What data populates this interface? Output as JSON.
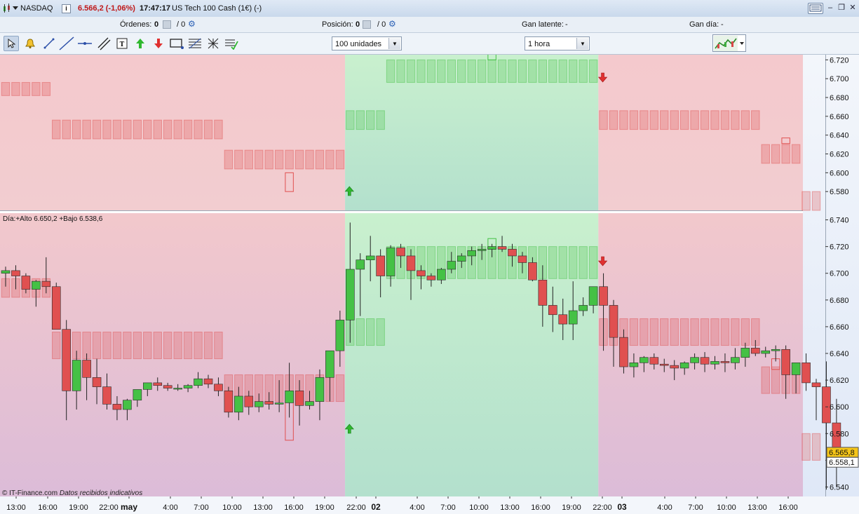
{
  "titlebar": {
    "market": "NASDAQ",
    "price": "6.566,2 (-1,06%)",
    "time": "17:47:17",
    "instrument": "US Tech 100 Cash (1€) (-)"
  },
  "statusbar": {
    "orders_label": "Órdenes:",
    "orders_value": "0",
    "orders_sep": "/ 0",
    "position_label": "Posición:",
    "position_value": "0",
    "position_sep": "/ 0",
    "latent_label": "Gan latente:",
    "latent_value": "-",
    "day_label": "Gan día:",
    "day_value": "-"
  },
  "toolbar": {
    "units_select": "100 unidades",
    "timeframe_select": "1 hora"
  },
  "tools": [
    "pointer-icon",
    "bell-icon",
    "segment-icon",
    "line-icon",
    "horizontal-line-icon",
    "channel-icon",
    "text-icon",
    "buy-arrow-icon",
    "sell-arrow-icon",
    "rectangle-icon",
    "fibonacci-icon",
    "grid-icon",
    "indicator-icon"
  ],
  "chart": {
    "info_label": "Día:+Alto 6.650,2 +Bajo 6.538,6",
    "last_price_tag": "6.565,8",
    "second_price_tag": "6.558,1",
    "footer_brand": "© IT-Finance.com",
    "footer_note": "Datos recibidos indicativos",
    "colors": {
      "bull": "#45c145",
      "bear": "#e05050",
      "bg_red": "#f2c8cc",
      "bg_green": "#c7ecd4",
      "bg_purple": "#dcb8d6"
    },
    "y_ticks_top": [
      "6.720",
      "6.700",
      "6.680",
      "6.660",
      "6.640",
      "6.620",
      "6.600",
      "6.580"
    ],
    "y_ticks_main": [
      "6.740",
      "6.720",
      "6.700",
      "6.680",
      "6.660",
      "6.640",
      "6.620",
      "6.600",
      "6.580",
      "6.560",
      "6.540"
    ],
    "x_ticks": [
      "13:00",
      "16:00",
      "19:00",
      "22:00",
      "may",
      "4:00",
      "7:00",
      "10:00",
      "13:00",
      "16:00",
      "19:00",
      "22:00",
      "02",
      "4:00",
      "7:00",
      "10:00",
      "13:00",
      "16:00",
      "19:00",
      "22:00",
      "03",
      "4:00",
      "7:00",
      "10:00",
      "13:00",
      "16:00"
    ],
    "bold_x": [
      "may",
      "02",
      "03"
    ]
  },
  "chart_data": {
    "type": "candlestick",
    "title": "US Tech 100 Cash (1€)",
    "timeframe": "1 hora",
    "ylim": [
      6530,
      6745
    ],
    "candles": [
      [
        6700,
        6705,
        6690,
        6702
      ],
      [
        6702,
        6706,
        6688,
        6698
      ],
      [
        6698,
        6700,
        6685,
        6688
      ],
      [
        6688,
        6695,
        6675,
        6694
      ],
      [
        6694,
        6712,
        6685,
        6690
      ],
      [
        6690,
        6693,
        6660,
        6658
      ],
      [
        6658,
        6665,
        6590,
        6612
      ],
      [
        6612,
        6642,
        6598,
        6635
      ],
      [
        6635,
        6640,
        6605,
        6622
      ],
      [
        6622,
        6636,
        6602,
        6615
      ],
      [
        6615,
        6625,
        6598,
        6602
      ],
      [
        6602,
        6608,
        6590,
        6598
      ],
      [
        6598,
        6606,
        6590,
        6605
      ],
      [
        6605,
        6610,
        6600,
        6613
      ],
      [
        6613,
        6618,
        6608,
        6618
      ],
      [
        6618,
        6622,
        6612,
        6616
      ],
      [
        6616,
        6618,
        6612,
        6614
      ],
      [
        6614,
        6617,
        6612,
        6614
      ],
      [
        6614,
        6617,
        6611,
        6616
      ],
      [
        6616,
        6626,
        6614,
        6621
      ],
      [
        6621,
        6624,
        6614,
        6617
      ],
      [
        6617,
        6622,
        6608,
        6612
      ],
      [
        6612,
        6615,
        6592,
        6596
      ],
      [
        6596,
        6615,
        6590,
        6608
      ],
      [
        6608,
        6612,
        6594,
        6600
      ],
      [
        6600,
        6610,
        6596,
        6604
      ],
      [
        6604,
        6611,
        6598,
        6602
      ],
      [
        6602,
        6620,
        6596,
        6603
      ],
      [
        6603,
        6633,
        6592,
        6612
      ],
      [
        6612,
        6620,
        6586,
        6601
      ],
      [
        6601,
        6612,
        6598,
        6604
      ],
      [
        6604,
        6628,
        6590,
        6622
      ],
      [
        6622,
        6640,
        6604,
        6642
      ],
      [
        6642,
        6672,
        6630,
        6665
      ],
      [
        6665,
        6738,
        6648,
        6703
      ],
      [
        6703,
        6715,
        6668,
        6710
      ],
      [
        6710,
        6728,
        6694,
        6713
      ],
      [
        6713,
        6718,
        6682,
        6698
      ],
      [
        6698,
        6721,
        6690,
        6719
      ],
      [
        6719,
        6722,
        6704,
        6713
      ],
      [
        6713,
        6718,
        6680,
        6702
      ],
      [
        6702,
        6706,
        6688,
        6698
      ],
      [
        6698,
        6700,
        6690,
        6695
      ],
      [
        6695,
        6704,
        6692,
        6703
      ],
      [
        6703,
        6716,
        6700,
        6709
      ],
      [
        6709,
        6715,
        6704,
        6713
      ],
      [
        6713,
        6720,
        6706,
        6717
      ],
      [
        6717,
        6722,
        6710,
        6718
      ],
      [
        6718,
        6722,
        6712,
        6720
      ],
      [
        6720,
        6728,
        6716,
        6718
      ],
      [
        6718,
        6722,
        6705,
        6713
      ],
      [
        6713,
        6716,
        6700,
        6708
      ],
      [
        6708,
        6712,
        6694,
        6695
      ],
      [
        6695,
        6706,
        6660,
        6676
      ],
      [
        6676,
        6690,
        6656,
        6669
      ],
      [
        6669,
        6681,
        6650,
        6662
      ],
      [
        6662,
        6694,
        6650,
        6672
      ],
      [
        6672,
        6682,
        6668,
        6676
      ],
      [
        6676,
        6690,
        6670,
        6690
      ],
      [
        6690,
        6700,
        6642,
        6676
      ],
      [
        6676,
        6680,
        6630,
        6652
      ],
      [
        6652,
        6658,
        6625,
        6630
      ],
      [
        6630,
        6640,
        6622,
        6633
      ],
      [
        6633,
        6638,
        6626,
        6637
      ],
      [
        6637,
        6640,
        6628,
        6632
      ],
      [
        6632,
        6636,
        6626,
        6631
      ],
      [
        6631,
        6635,
        6620,
        6629
      ],
      [
        6629,
        6634,
        6624,
        6633
      ],
      [
        6633,
        6640,
        6628,
        6637
      ],
      [
        6637,
        6641,
        6626,
        6632
      ],
      [
        6632,
        6638,
        6628,
        6634
      ],
      [
        6634,
        6640,
        6626,
        6633
      ],
      [
        6633,
        6644,
        6628,
        6637
      ],
      [
        6637,
        6648,
        6630,
        6644
      ],
      [
        6644,
        6650,
        6638,
        6640
      ],
      [
        6640,
        6645,
        6637,
        6642
      ],
      [
        6642,
        6646,
        6634,
        6643
      ],
      [
        6643,
        6646,
        6606,
        6624
      ],
      [
        6624,
        6632,
        6610,
        6633
      ],
      [
        6633,
        6640,
        6612,
        6618
      ],
      [
        6618,
        6621,
        6590,
        6615
      ],
      [
        6615,
        6634,
        6538,
        6588
      ],
      [
        6588,
        6606,
        6540,
        6558
      ]
    ],
    "levels": [
      {
        "range": [
          6682,
          6696
        ],
        "color": "bear",
        "start": 0,
        "end": 5
      },
      {
        "range": [
          6636,
          6656
        ],
        "color": "bear",
        "start": 5,
        "end": 22
      },
      {
        "range": [
          6604,
          6624
        ],
        "color": "bear",
        "start": 22,
        "end": 34
      },
      {
        "range": [
          6646,
          6666
        ],
        "color": "bull",
        "start": 34,
        "end": 38
      },
      {
        "range": [
          6696,
          6720
        ],
        "color": "bull",
        "start": 38,
        "end": 59
      },
      {
        "range": [
          6646,
          6666
        ],
        "color": "bear",
        "start": 59,
        "end": 75
      },
      {
        "range": [
          6610,
          6630
        ],
        "color": "bear",
        "start": 75,
        "end": 79
      },
      {
        "range": [
          6560,
          6580
        ],
        "color": "bear",
        "start": 79,
        "end": 81
      }
    ],
    "zones": [
      {
        "color": "bear",
        "start": 0,
        "end": 34
      },
      {
        "color": "bull",
        "start": 34,
        "end": 59
      },
      {
        "color": "bear",
        "start": 59,
        "end": 83
      }
    ]
  }
}
